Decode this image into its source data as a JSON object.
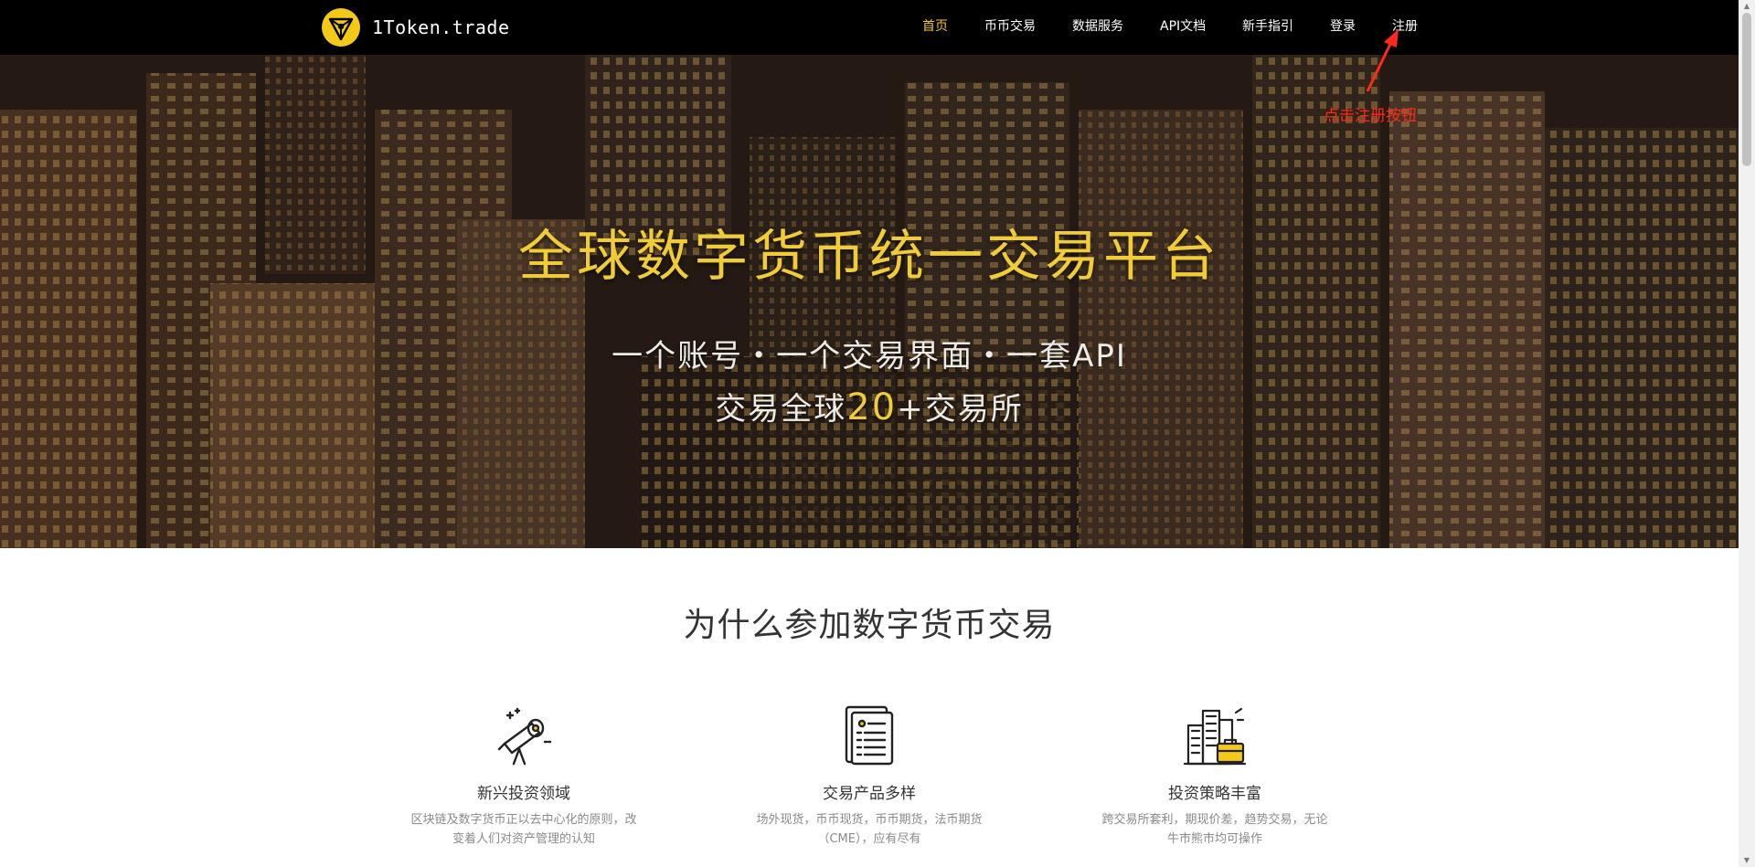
{
  "brand": {
    "name": "1Token.trade",
    "accent": "#f5c918"
  },
  "nav": {
    "items": [
      {
        "label": "首页",
        "active": true
      },
      {
        "label": "币币交易",
        "active": false
      },
      {
        "label": "数据服务",
        "active": false
      },
      {
        "label": "API文档",
        "active": false
      },
      {
        "label": "新手指引",
        "active": false
      },
      {
        "label": "登录",
        "active": false
      },
      {
        "label": "注册",
        "active": false
      }
    ]
  },
  "annotation": {
    "text": "点击注册按钮",
    "color": "#ff2a1a"
  },
  "hero": {
    "title": "全球数字货币统一交易平台",
    "subtitle_line1": "一个账号・一个交易界面・一套API",
    "subtitle_line2_prefix": "交易全球",
    "subtitle_line2_number": "20",
    "subtitle_line2_suffix": "+交易所"
  },
  "why": {
    "title": "为什么参加数字货币交易",
    "features": [
      {
        "icon": "telescope-icon",
        "title": "新兴投资领域",
        "desc": "区块链及数字货币正以去中心化的原则，改变着人们对资产管理的认知"
      },
      {
        "icon": "document-icon",
        "title": "交易产品多样",
        "desc": "场外现货，币币现货，币币期货，法币期货（CME），应有尽有"
      },
      {
        "icon": "city-briefcase-icon",
        "title": "投资策略丰富",
        "desc": "跨交易所套利，期现价差，趋势交易，无论牛市熊市均可操作"
      }
    ]
  }
}
